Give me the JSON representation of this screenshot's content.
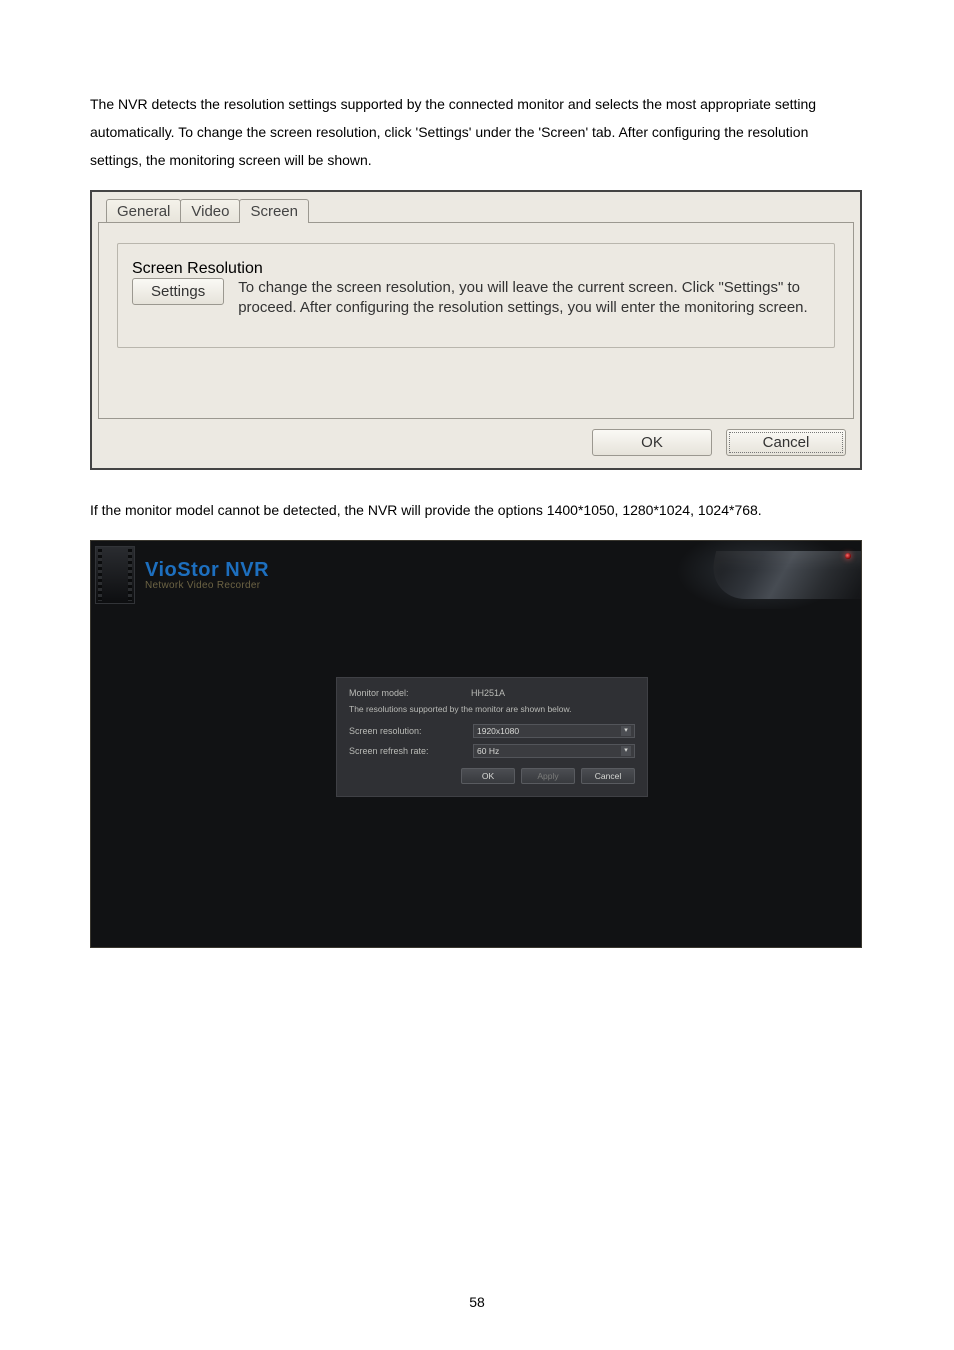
{
  "p1": "The NVR detects the resolution settings supported by the connected monitor and selects the most appropriate setting automatically.   To change the screen resolution, click 'Settings' under the 'Screen' tab.    After configuring the resolution settings, the monitoring screen will be shown.",
  "p2": "If the monitor model cannot be detected, the NVR will provide the options 1400*1050, 1280*1024, 1024*768.",
  "page_number": "58",
  "dlg": {
    "tabs": {
      "general": "General",
      "video": "Video",
      "screen": "Screen"
    },
    "group_title": "Screen Resolution",
    "settings_btn": "Settings",
    "description": "To change the screen resolution, you will leave the current screen. Click \"Settings\" to proceed. After configuring the resolution settings, you will enter the monitoring screen.",
    "ok": "OK",
    "cancel": "Cancel"
  },
  "nvr": {
    "brand": "VioStor NVR",
    "brand_sub": "Network Video Recorder",
    "monitor_model_label": "Monitor model:",
    "monitor_model_value": "HH251A",
    "supported_text": "The resolutions supported by the monitor are shown below.",
    "resolution_label": "Screen resolution:",
    "resolution_value": "1920x1080",
    "refresh_label": "Screen refresh rate:",
    "refresh_value": "60 Hz",
    "ok": "OK",
    "apply": "Apply",
    "cancel": "Cancel"
  }
}
